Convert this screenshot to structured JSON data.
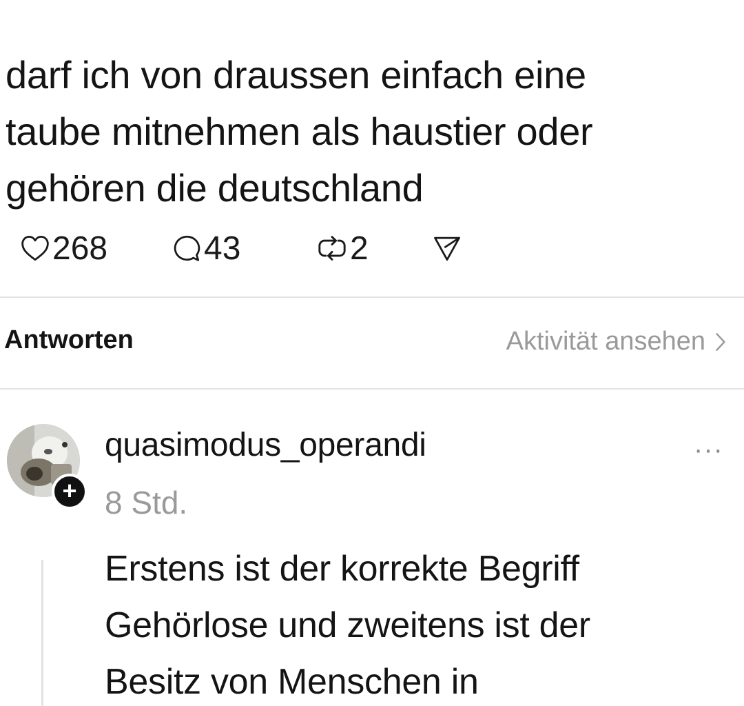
{
  "post": {
    "lines": [
      "darf ich von draussen einfach eine",
      "taube mitnehmen als haustier oder",
      "gehören die deutschland"
    ],
    "likes": "268",
    "replies": "43",
    "reposts": "2",
    "icons": [
      "heart-icon",
      "comment-icon",
      "repost-icon",
      "share-icon"
    ]
  },
  "replies_section": {
    "header": "Antworten",
    "activity_link": "Aktivität ansehen"
  },
  "reply": {
    "username": "quasimodus_operandi",
    "time": "8 Std.",
    "more": "···",
    "follow_plus": "+",
    "lines": [
      "Erstens ist der korrekte Begriff",
      "Gehörlose und zweitens ist der",
      "Besitz von Menschen in"
    ]
  }
}
